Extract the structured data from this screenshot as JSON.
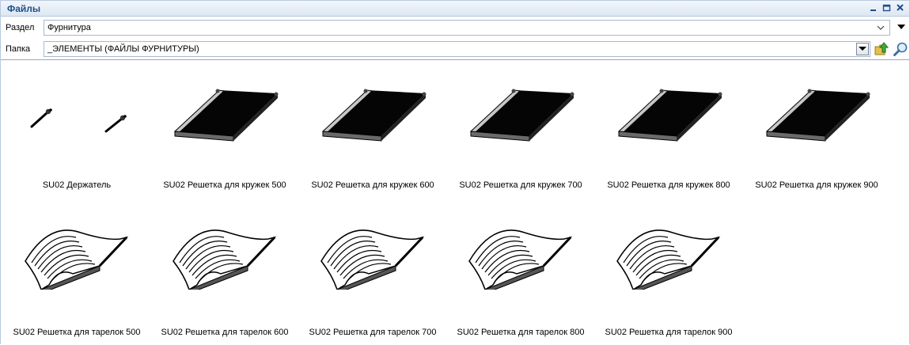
{
  "panel": {
    "title": "Файлы",
    "controls": [
      "minimize-icon",
      "restore-icon",
      "close-icon"
    ]
  },
  "section": {
    "label": "Раздел",
    "value": "Фурнитура"
  },
  "folder": {
    "label": "Папка",
    "value": "_ЭЛЕМЕНТЫ (ФАЙЛЫ ФУРНИТУРЫ)"
  },
  "items": [
    {
      "name": "SU02 Держатель",
      "thumb": "holder"
    },
    {
      "name": "SU02 Решетка для кружек 500",
      "thumb": "tray"
    },
    {
      "name": "SU02 Решетка для кружек 600",
      "thumb": "tray"
    },
    {
      "name": "SU02 Решетка для кружек 700",
      "thumb": "tray"
    },
    {
      "name": "SU02 Решетка для кружек 800",
      "thumb": "tray"
    },
    {
      "name": "SU02 Решетка для кружек 900",
      "thumb": "tray"
    },
    {
      "name": "SU02 Решетка для тарелок 500",
      "thumb": "rack"
    },
    {
      "name": "SU02 Решетка для тарелок 600",
      "thumb": "rack"
    },
    {
      "name": "SU02 Решетка для тарелок 700",
      "thumb": "rack"
    },
    {
      "name": "SU02 Решетка для тарелок 800",
      "thumb": "rack"
    },
    {
      "name": "SU02 Решетка для тарелок 900",
      "thumb": "rack"
    }
  ]
}
